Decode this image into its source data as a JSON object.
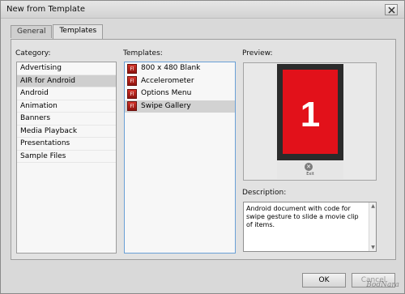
{
  "window": {
    "title": "New from Template",
    "close_icon": "close-icon"
  },
  "tabs": [
    {
      "label": "General",
      "selected": false
    },
    {
      "label": "Templates",
      "selected": true
    }
  ],
  "category": {
    "label": "Category:",
    "items": [
      {
        "label": "Advertising",
        "selected": false
      },
      {
        "label": "AIR for Android",
        "selected": true
      },
      {
        "label": "Android",
        "selected": false
      },
      {
        "label": "Animation",
        "selected": false
      },
      {
        "label": "Banners",
        "selected": false
      },
      {
        "label": "Media Playback",
        "selected": false
      },
      {
        "label": "Presentations",
        "selected": false
      },
      {
        "label": "Sample Files",
        "selected": false
      }
    ]
  },
  "templates": {
    "label": "Templates:",
    "items": [
      {
        "label": "800 x 480 Blank",
        "selected": false,
        "icon": "fl-file-icon"
      },
      {
        "label": "Accelerometer",
        "selected": false,
        "icon": "fl-file-icon"
      },
      {
        "label": "Options Menu",
        "selected": false,
        "icon": "fl-file-icon"
      },
      {
        "label": "Swipe Gallery",
        "selected": true,
        "icon": "fl-file-icon"
      }
    ]
  },
  "preview": {
    "label": "Preview:",
    "phone_number": "1",
    "exit_label": "Exit",
    "colors": {
      "screen": "#e2111a",
      "frame": "#2b2b2b"
    }
  },
  "description": {
    "label": "Description:",
    "text": "Android document with code for swipe gesture to slide a movie clip of items."
  },
  "buttons": {
    "ok": "OK",
    "cancel": "Cancel"
  },
  "watermark": "BodNara"
}
